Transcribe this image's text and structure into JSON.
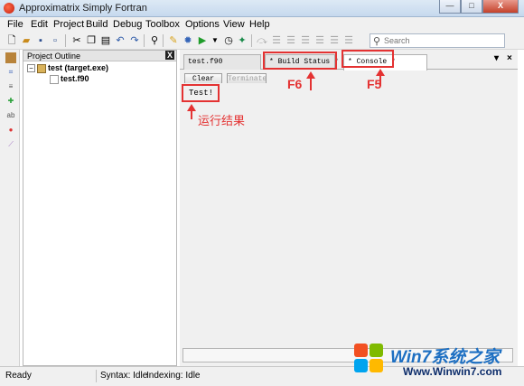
{
  "window": {
    "title": "Approximatrix Simply Fortran",
    "min": "—",
    "max": "□",
    "close": "X"
  },
  "menu": [
    "File",
    "Edit",
    "Project",
    "Build",
    "Debug",
    "Toolbox",
    "Options",
    "View",
    "Help"
  ],
  "toolbar": {
    "search_placeholder": "Search"
  },
  "outline": {
    "title": "Project Outline",
    "close": "X",
    "tree": [
      {
        "label": "test (target.exe)",
        "toggle": "−"
      },
      {
        "label": "test.f90"
      }
    ]
  },
  "tabs": [
    {
      "label": "test.f90"
    },
    {
      "label": "* Build Status *"
    },
    {
      "label": "* Console *"
    }
  ],
  "tab_controls": {
    "dropdown": "▾",
    "close": "×"
  },
  "console": {
    "clear_label": "Clear",
    "terminate_label": "Terminate",
    "output": "Test!"
  },
  "annotations": {
    "f6": "F6",
    "f5": "F5",
    "result": "运行结果"
  },
  "status": {
    "ready": "Ready",
    "syntax": "Syntax: Idle",
    "indexing": "Indexing: Idle"
  },
  "watermark": {
    "logo": "Win7系统之家",
    "url": "Www.Winwin7.com"
  },
  "colors": {
    "highlight": "#e43232",
    "titlebar": "#cfe0f2"
  }
}
